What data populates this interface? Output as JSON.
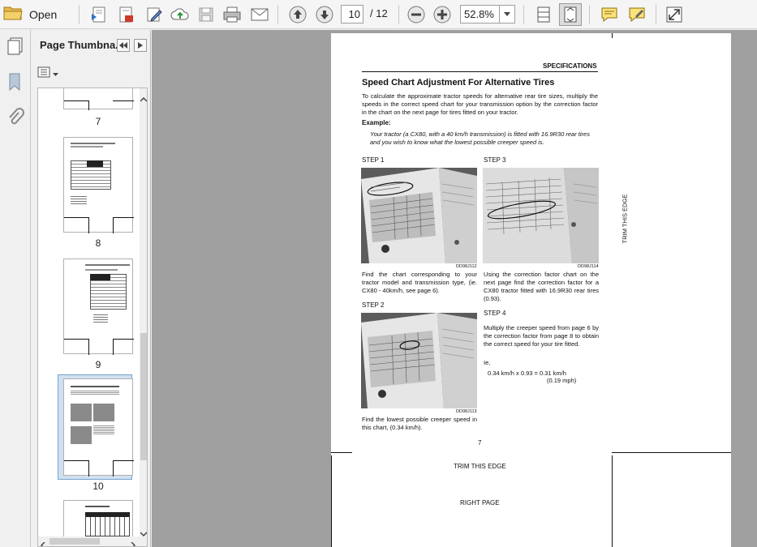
{
  "toolbar": {
    "open_label": "Open",
    "current_page": "10",
    "page_total": "/ 12",
    "zoom": "52.8%"
  },
  "panel": {
    "title": "Page Thumbna...",
    "thumbnails": [
      {
        "label": "7"
      },
      {
        "label": "8"
      },
      {
        "label": "9"
      },
      {
        "label": "10"
      }
    ]
  },
  "document": {
    "header": "SPECIFICATIONS",
    "title": "Speed Chart Adjustment For Alternative Tires",
    "intro": "To calculate the approximate tractor speeds for alternative rear tire sizes, multiply the speeds in the correct speed chart for your transmission option by the correction factor in the chart on the next page for tires fitted on your tractor.",
    "example_label": "Example:",
    "example_text": "Your tractor (a CX80, with a 40 km/h transmission) is fitted with 16.9R30 rear tires and you wish to know what the lowest possible creeper speed is.",
    "step1_label": "STEP  1",
    "step1_caption": "DD98J112",
    "step1_text": "Find the chart corresponding to your tractor model and transmission type, (ie. CX80 - 40km/h, see page 6).",
    "step2_label": "STEP  2",
    "step2_caption": "DD98J113",
    "step2_text": "Find the lowest possible creeper speed in this chart, (0.34 km/h).",
    "step3_label": "STEP  3",
    "step3_caption": "DD98J114",
    "step3_text": "Using the correction factor chart on the next page find the correction factor for a CX80 tractor fitted with 16.9R30 rear tires (0.93).",
    "step4_label": "STEP  4",
    "step4_text": "Multiply the creeper speed from page 6 by the correction factor from page 8 to obtain the correct speed for your tire fitted.",
    "ie": "Ie,",
    "formula": "0.34 km/h x 0.93 = 0.31 km/h",
    "formula_mph": "(0.19 mph)",
    "page_number": "7",
    "trim_side": "TRIM THIS EDGE",
    "trim_bottom": "TRIM THIS EDGE",
    "right_page": "RIGHT PAGE"
  }
}
